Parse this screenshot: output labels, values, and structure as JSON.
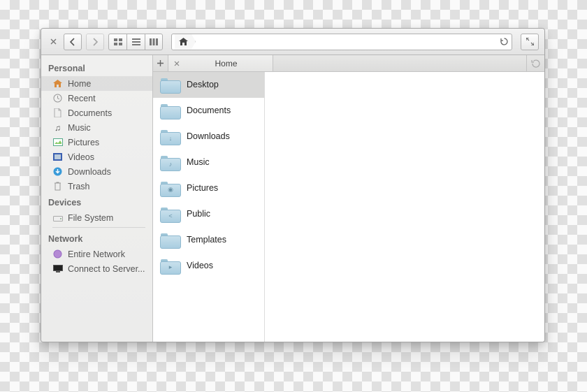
{
  "toolbar": {
    "path_current": ""
  },
  "tabs": {
    "active_label": "Home"
  },
  "sidebar": {
    "sections": [
      {
        "title": "Personal",
        "items": [
          {
            "label": "Home"
          },
          {
            "label": "Recent"
          },
          {
            "label": "Documents"
          },
          {
            "label": "Music"
          },
          {
            "label": "Pictures"
          },
          {
            "label": "Videos"
          },
          {
            "label": "Downloads"
          },
          {
            "label": "Trash"
          }
        ]
      },
      {
        "title": "Devices",
        "items": [
          {
            "label": "File System"
          }
        ]
      },
      {
        "title": "Network",
        "items": [
          {
            "label": "Entire Network"
          },
          {
            "label": "Connect to Server..."
          }
        ]
      }
    ]
  },
  "column": {
    "items": [
      {
        "label": "Desktop"
      },
      {
        "label": "Documents"
      },
      {
        "label": "Downloads"
      },
      {
        "label": "Music"
      },
      {
        "label": "Pictures"
      },
      {
        "label": "Public"
      },
      {
        "label": "Templates"
      },
      {
        "label": "Videos"
      }
    ]
  }
}
